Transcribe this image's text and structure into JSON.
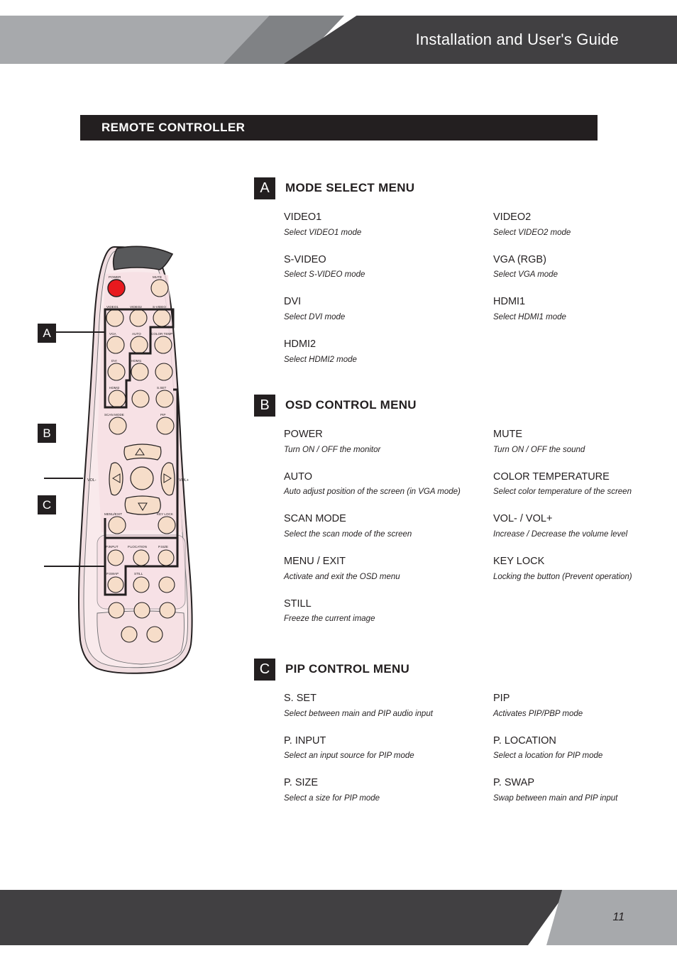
{
  "header": {
    "title": "Installation and User's Guide"
  },
  "section": {
    "title": "REMOTE CONTROLLER"
  },
  "footer": {
    "page_number": "11"
  },
  "colors": {
    "header_light": "#a7a9ac",
    "header_mid": "#808285",
    "header_dark": "#414042",
    "section_bar": "#231f20",
    "remote_body": "#f7dfe4",
    "remote_face": "#f9e6ea",
    "button_face": "#f6ddc9",
    "power_button": "#e8191e",
    "emitter": "#58595b",
    "outline": "#231f20"
  },
  "callouts": [
    {
      "letter": "A",
      "target": "mode-select-group"
    },
    {
      "letter": "B",
      "target": "osd-control-group"
    },
    {
      "letter": "C",
      "target": "pip-control-group"
    }
  ],
  "groups": [
    {
      "badge": "A",
      "title": "MODE SELECT MENU",
      "left": [
        {
          "name": "VIDEO1",
          "desc": "Select VIDEO1 mode"
        },
        {
          "name": "S-VIDEO",
          "desc": "Select S-VIDEO mode"
        },
        {
          "name": "DVI",
          "desc": "Select DVI mode"
        },
        {
          "name": "HDMI2",
          "desc": "Select HDMI2 mode"
        }
      ],
      "right": [
        {
          "name": "VIDEO2",
          "desc": "Select VIDEO2 mode"
        },
        {
          "name": "VGA (RGB)",
          "desc": "Select VGA mode"
        },
        {
          "name": "HDMI1",
          "desc": "Select HDMI1 mode"
        }
      ]
    },
    {
      "badge": "B",
      "title": "OSD CONTROL MENU",
      "left": [
        {
          "name": "POWER",
          "desc": "Turn ON / OFF the monitor"
        },
        {
          "name": "AUTO",
          "desc": "Auto adjust position of the screen (in VGA mode)"
        },
        {
          "name": "SCAN MODE",
          "desc": "Select the scan mode of the screen"
        },
        {
          "name": "MENU / EXIT",
          "desc": "Activate and exit the OSD menu"
        },
        {
          "name": "STILL",
          "desc": "Freeze the current image"
        }
      ],
      "right": [
        {
          "name": "MUTE",
          "desc": "Turn ON / OFF the sound"
        },
        {
          "name": "COLOR TEMPERATURE",
          "desc": "Select color temperature of the screen"
        },
        {
          "name": "VOL- / VOL+",
          "desc": "Increase / Decrease the volume level"
        },
        {
          "name": "KEY LOCK",
          "desc": "Locking the button (Prevent operation)"
        }
      ]
    },
    {
      "badge": "C",
      "title": "PIP CONTROL MENU",
      "left": [
        {
          "name": "S. SET",
          "desc": "Select between main and PIP audio input"
        },
        {
          "name": "P. INPUT",
          "desc": "Select an input source for PIP mode"
        },
        {
          "name": "P. SIZE",
          "desc": "Select a size for PIP mode"
        }
      ],
      "right": [
        {
          "name": "PIP",
          "desc": "Activates PIP/PBP mode"
        },
        {
          "name": "P. LOCATION",
          "desc": "Select a location for PIP mode"
        },
        {
          "name": "P. SWAP",
          "desc": "Swap between main and PIP input"
        }
      ]
    }
  ],
  "remote": {
    "button_labels": {
      "power": "POWER",
      "mute": "MUTE",
      "video1": "VIDEO1",
      "video2": "VIDEO2",
      "svideo": "S-VIDEO",
      "vga": "VGA",
      "auto": "AUTO",
      "color_temp": "COLOR TEMP",
      "dvi": "DVI",
      "hdmi1": "HDMI1",
      "hdmi2": "HDMI2",
      "scan_mode": "SCAN MODE",
      "s_set": "S.SET",
      "pip": "PIP",
      "vol_minus": "VOL-",
      "vol_plus": "VOL+",
      "menu_exit": "MENU/EXIT",
      "key_lock": "KEY LOCK",
      "p_input": "P.INPUT",
      "p_location": "P.LOCATION",
      "p_size": "P.SIZE",
      "p_swap": "P.SWAP",
      "still": "STILL"
    }
  }
}
